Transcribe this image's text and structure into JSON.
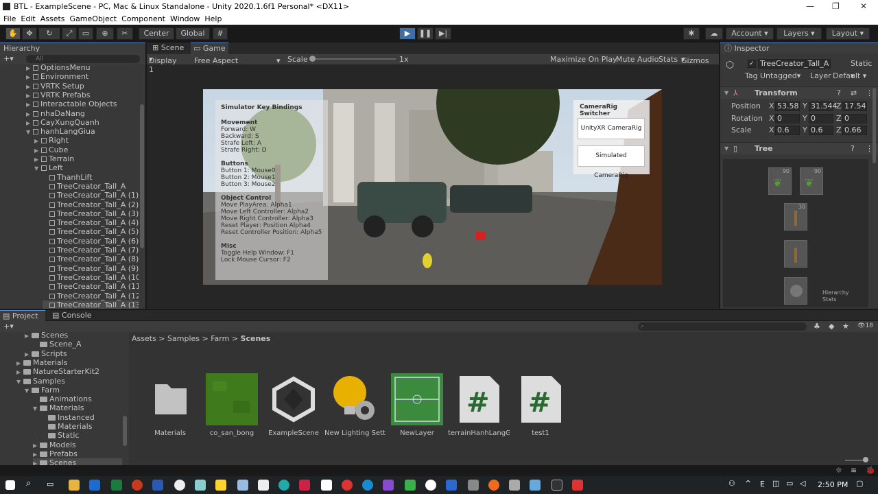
{
  "window": {
    "title": "BTL - ExampleScene - PC, Mac & Linux Standalone - Unity 2020.1.6f1 Personal* <DX11>"
  },
  "menu": [
    "File",
    "Edit",
    "Assets",
    "GameObject",
    "Component",
    "Window",
    "Help"
  ],
  "toolbar": {
    "pivot": "Center",
    "space": "Global",
    "account": "Account",
    "layers": "Layers",
    "layout": "Layout"
  },
  "hierarchy": {
    "title": "Hierarchy",
    "search_placeholder": "All",
    "items": [
      {
        "label": "OptionsMenu",
        "depth": 0
      },
      {
        "label": "Environment",
        "depth": 0
      },
      {
        "label": "VRTK Setup",
        "depth": 0
      },
      {
        "label": "VRTK Prefabs",
        "depth": 0
      },
      {
        "label": "Interactable Objects",
        "depth": 0
      },
      {
        "label": "nhaDaNang",
        "depth": 0
      },
      {
        "label": "CayXungQuanh",
        "depth": 0
      },
      {
        "label": "hanhLangGiua",
        "depth": 0
      },
      {
        "label": "Right",
        "depth": 1
      },
      {
        "label": "Cube",
        "depth": 1
      },
      {
        "label": "Terrain",
        "depth": 1
      },
      {
        "label": "Left",
        "depth": 1
      },
      {
        "label": "ThanhLift",
        "depth": 2
      },
      {
        "label": "TreeCreator_Tall_A",
        "depth": 2
      },
      {
        "label": "TreeCreator_Tall_A (1)",
        "depth": 2
      },
      {
        "label": "TreeCreator_Tall_A (2)",
        "depth": 2
      },
      {
        "label": "TreeCreator_Tall_A (3)",
        "depth": 2
      },
      {
        "label": "TreeCreator_Tall_A (4)",
        "depth": 2
      },
      {
        "label": "TreeCreator_Tall_A (5)",
        "depth": 2
      },
      {
        "label": "TreeCreator_Tall_A (6)",
        "depth": 2
      },
      {
        "label": "TreeCreator_Tall_A (7)",
        "depth": 2
      },
      {
        "label": "TreeCreator_Tall_A (8)",
        "depth": 2
      },
      {
        "label": "TreeCreator_Tall_A (9)",
        "depth": 2
      },
      {
        "label": "TreeCreator_Tall_A (10)",
        "depth": 2
      },
      {
        "label": "TreeCreator_Tall_A (11)",
        "depth": 2
      },
      {
        "label": "TreeCreator_Tall_A (12)",
        "depth": 2
      },
      {
        "label": "TreeCreator_Tall_A (13)",
        "depth": 2
      }
    ]
  },
  "game": {
    "tabs": [
      "Scene",
      "Game"
    ],
    "display": "Display 1",
    "aspect": "Free Aspect",
    "scale_label": "Scale",
    "scale_value": "1x",
    "options": [
      "Maximize On Play",
      "Mute Audio",
      "Stats",
      "Gizmos"
    ],
    "keybindings": {
      "title": "Simulator Key Bindings",
      "sections": [
        {
          "head": "Movement",
          "lines": [
            "Forward: W",
            "Backward: S",
            "Strafe Left: A",
            "Strafe Right: D"
          ]
        },
        {
          "head": "Buttons",
          "lines": [
            "Button 1: Mouse0",
            "Button 2: Mouse1",
            "Button 3: Mouse2"
          ]
        },
        {
          "head": "Object Control",
          "lines": [
            "Move PlayArea: Alpha1",
            "Move Left Controller: Alpha2",
            "Move Right Controller: Alpha3",
            "Reset Player: Position Alpha4",
            "Reset Controller Position: Alpha5"
          ]
        },
        {
          "head": "Misc",
          "lines": [
            "Toggle Help Window: F1",
            "Lock Mouse Cursor: F2"
          ]
        }
      ]
    },
    "switcher": {
      "title": "CameraRig Switcher",
      "btn1": "UnityXR CameraRig",
      "btn2": "Simulated CameraRig"
    }
  },
  "inspector": {
    "title": "Inspector",
    "object_name": "TreeCreator_Tall_A",
    "static_label": "Static",
    "tag_label": "Tag",
    "tag_value": "Untagged",
    "layer_label": "Layer",
    "layer_value": "Default",
    "transform": {
      "title": "Transform",
      "position": {
        "label": "Position",
        "x": "53.58",
        "y": "31.544",
        "z": "17.54"
      },
      "rotation": {
        "label": "Rotation",
        "x": "0",
        "y": "0",
        "z": "0"
      },
      "scale": {
        "label": "Scale",
        "x": "0.6",
        "y": "0.6",
        "z": "0.66"
      }
    },
    "tree": {
      "title": "Tree",
      "node_values": [
        "90",
        "90",
        "30"
      ],
      "stats_label": "Hierarchy Stats"
    }
  },
  "project": {
    "tabs": [
      "Project",
      "Console"
    ],
    "breadcrumb": [
      "Assets",
      "Samples",
      "Farm",
      "Scenes"
    ],
    "badge": "18",
    "tree": [
      {
        "label": "Scenes",
        "depth": 2
      },
      {
        "label": "Scene_A",
        "depth": 3
      },
      {
        "label": "Scripts",
        "depth": 2
      },
      {
        "label": "Materials",
        "depth": 1
      },
      {
        "label": "NatureStarterKit2",
        "depth": 1
      },
      {
        "label": "Samples",
        "depth": 1
      },
      {
        "label": "Farm",
        "depth": 2
      },
      {
        "label": "Animations",
        "depth": 3
      },
      {
        "label": "Materials",
        "depth": 3
      },
      {
        "label": "Instanced",
        "depth": 4
      },
      {
        "label": "Materials",
        "depth": 4
      },
      {
        "label": "Static",
        "depth": 4
      },
      {
        "label": "Models",
        "depth": 3
      },
      {
        "label": "Prefabs",
        "depth": 3
      },
      {
        "label": "Scenes",
        "depth": 3
      }
    ],
    "assets": [
      {
        "label": "Materials",
        "icon": "folder-icon"
      },
      {
        "label": "co_san_bong",
        "icon": "grass-texture-icon"
      },
      {
        "label": "ExampleScene",
        "icon": "unity-scene-icon"
      },
      {
        "label": "New Lighting Sett...",
        "icon": "lighting-settings-icon"
      },
      {
        "label": "NewLayer",
        "icon": "terrain-layer-icon"
      },
      {
        "label": "terrainHanhLangG...",
        "icon": "csharp-script-icon"
      },
      {
        "label": "test1",
        "icon": "csharp-script-icon"
      }
    ]
  },
  "taskbar": {
    "time": "2:50 PM",
    "lang": "E"
  }
}
